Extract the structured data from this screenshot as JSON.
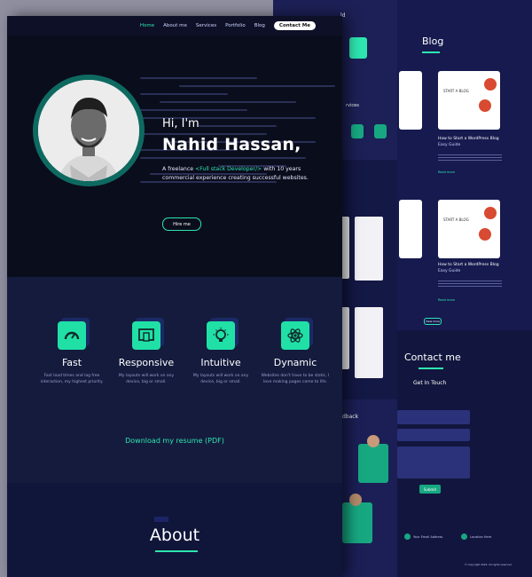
{
  "nav": {
    "items": [
      "Home",
      "About me",
      "Services",
      "Portfolio",
      "Blog"
    ],
    "contact_label": "Contact Me"
  },
  "hero": {
    "greeting": "Hi, I'm",
    "name": "Nahid Hassan,",
    "bio_prefix": "A freelance ",
    "bio_accent": "<Full stack Developer/>",
    "bio_suffix": " with 10 years commercial experience creating successful websites.",
    "hire_label": "Hire me"
  },
  "features": [
    {
      "title": "Fast",
      "desc": "Fast load times and lag free interaction, my highest priority."
    },
    {
      "title": "Responsive",
      "desc": "My layouts will work on any device, big or small."
    },
    {
      "title": "Intuitive",
      "desc": "My layouts will work on any device, big or small."
    },
    {
      "title": "Dynamic",
      "desc": "Websites don't have to be static, I love making pages come to life."
    }
  ],
  "resume_label": "Download my resume (PDF)",
  "about_title": "About",
  "mid": {
    "label_top": "ld",
    "label_services": "rvices",
    "label_feedback": "dback"
  },
  "blog": {
    "title": "Blog",
    "posts": [
      {
        "title": "How to Start a WordPress Blog",
        "subtitle": "Easy Guide",
        "read_more": "Read more"
      },
      {
        "title": "How to Start a WordPress Blog",
        "subtitle": "Easy Guide",
        "read_more": "Read more"
      }
    ],
    "card_label": "START A BLOG",
    "more_label": "View more"
  },
  "contact": {
    "title": "Contact me",
    "subtitle": "Get In Touch",
    "submit_label": "Submit",
    "email_label": "Your Email Address",
    "location_label": "Location Here",
    "copyright": "© Copyright 2022. All rights reserved."
  },
  "colors": {
    "accent": "#2ee6b0",
    "accent_dark": "#17a882",
    "bg_dark": "#0a0d1c",
    "bg_navy": "#141b3d"
  }
}
